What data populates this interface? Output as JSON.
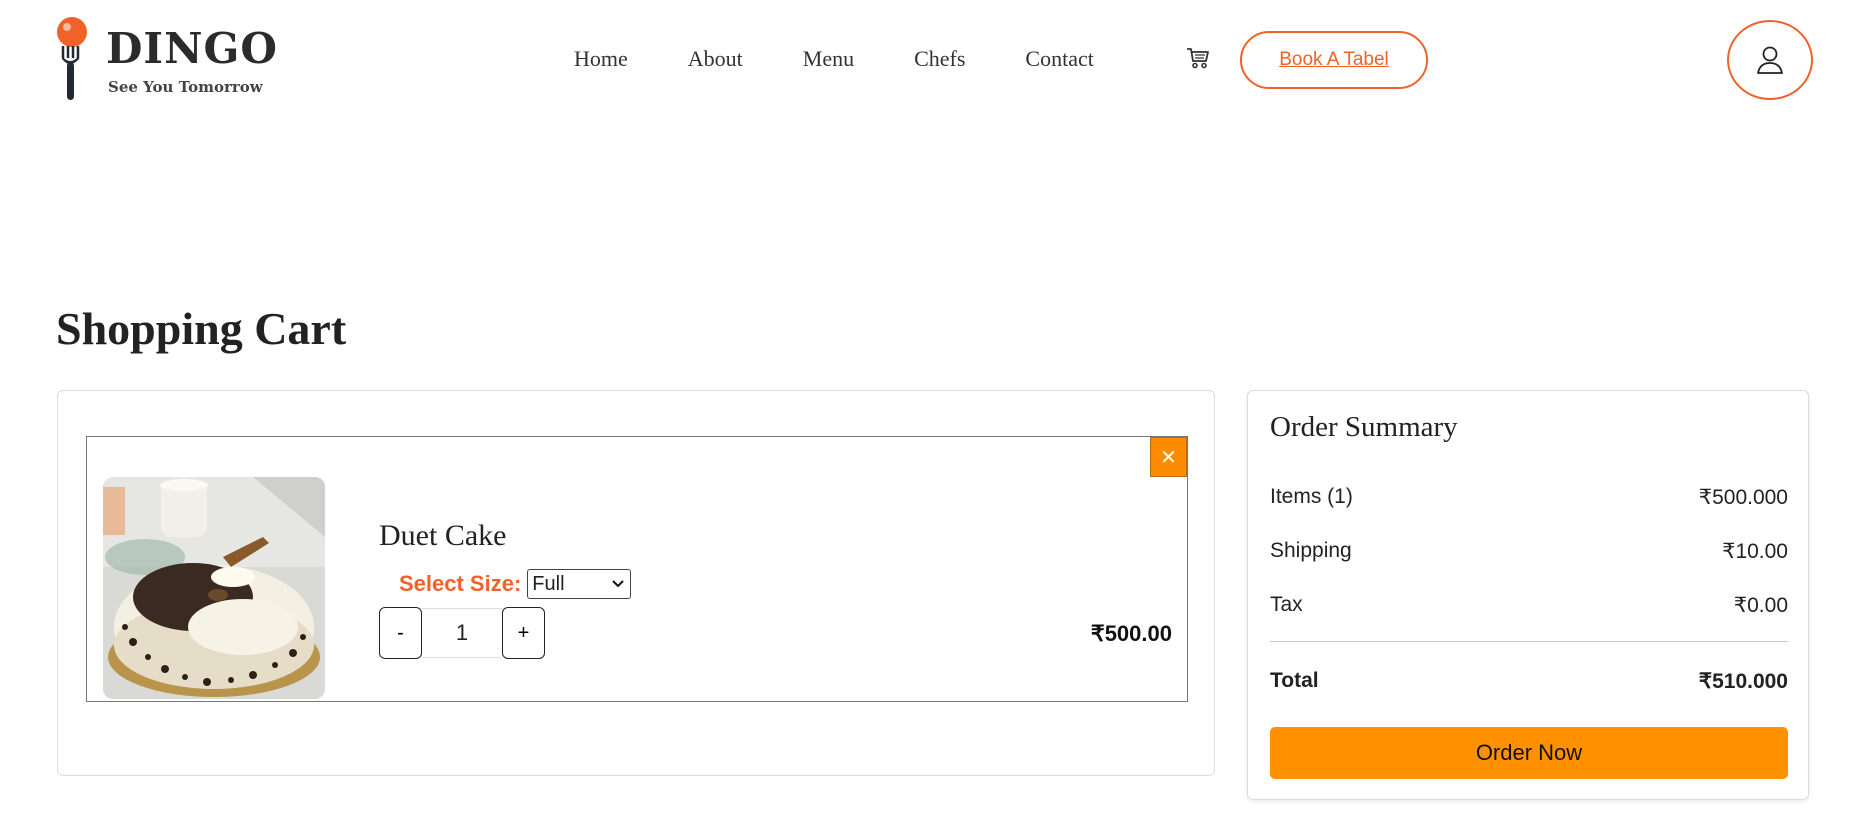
{
  "brand": {
    "name": "DINGO",
    "tagline": "See You Tomorrow",
    "accent_color": "#f0622a",
    "icon": "fork-with-orange-ball-icon"
  },
  "nav": {
    "items": [
      {
        "label": "Home"
      },
      {
        "label": "About"
      },
      {
        "label": "Menu"
      },
      {
        "label": "Chefs"
      },
      {
        "label": "Contact"
      }
    ],
    "cart_icon": "shopping-cart-icon",
    "book_label": "Book A Tabel",
    "user_icon": "user-icon"
  },
  "page": {
    "title": "Shopping Cart"
  },
  "cart": {
    "items": [
      {
        "name": "Duet Cake",
        "size_label": "Select Size:",
        "size_value": "Full",
        "quantity": "1",
        "decrement_label": "-",
        "increment_label": "+",
        "price": "₹500.00",
        "remove_label": "✕",
        "image": "duet-cake-photo"
      }
    ],
    "remove_color": "#ff8c00"
  },
  "summary": {
    "title": "Order Summary",
    "items_label": "Items (1)",
    "items_value": "₹500.000",
    "shipping_label": "Shipping",
    "shipping_value": "₹10.00",
    "tax_label": "Tax",
    "tax_value": "₹0.00",
    "total_label": "Total",
    "total_value": "₹510.000",
    "order_label": "Order Now",
    "order_color": "#ff9000"
  }
}
